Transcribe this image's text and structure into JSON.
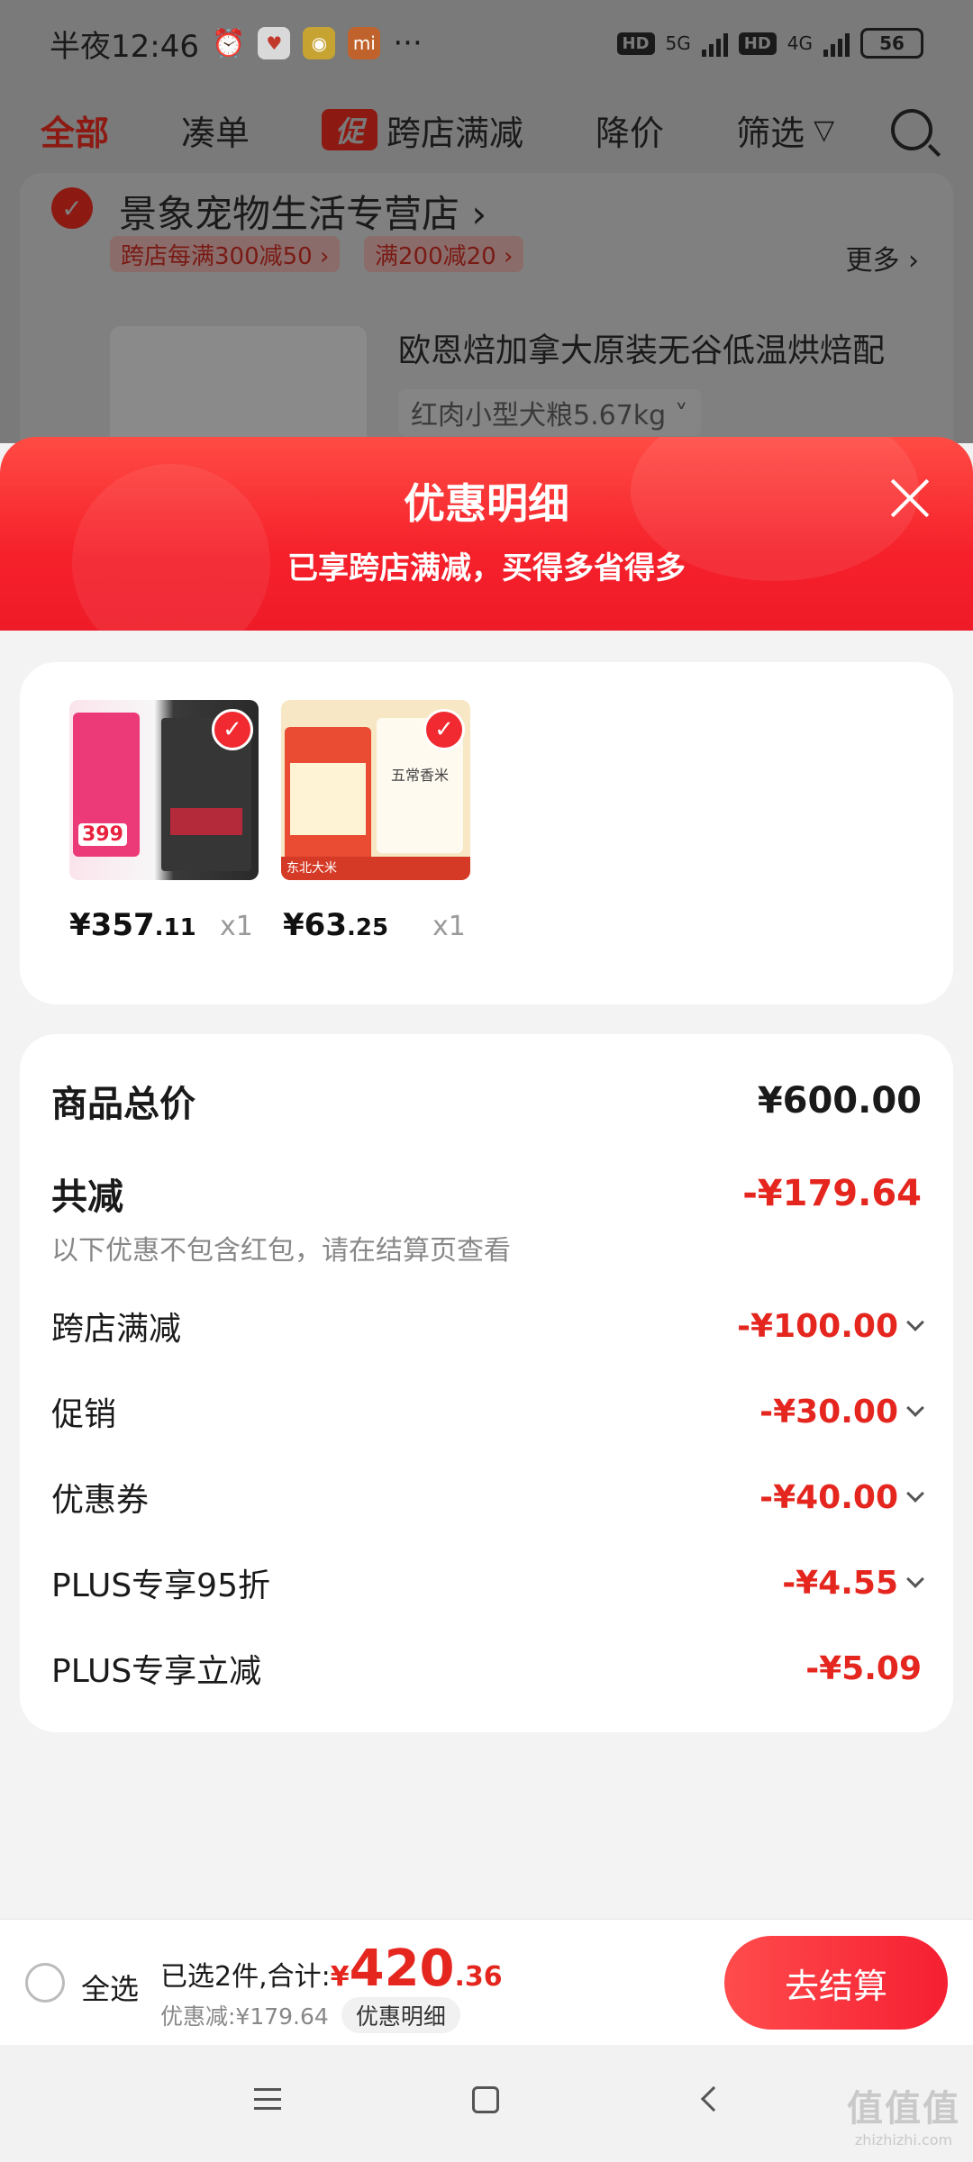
{
  "status_bar": {
    "time": "半夜12:46",
    "net1": "5G",
    "net2": "4G",
    "hd": "HD",
    "battery": "56"
  },
  "top_nav": {
    "tabs": [
      "全部",
      "凑单",
      "跨店满减",
      "降价",
      "筛选"
    ],
    "promo_badge": "促"
  },
  "store": {
    "name": "景象宠物生活专营店",
    "tags": [
      "跨店每满300减50",
      "满200减20"
    ],
    "more": "更多",
    "product_title": "欧恩焙加拿大原装无谷低温烘焙配",
    "product_spec": "红肉小型犬粮5.67kg"
  },
  "sheet": {
    "title": "优惠明细",
    "subtitle": "已享跨店满减，买得多省得多"
  },
  "products": [
    {
      "price_int": "¥357",
      "price_dec": ".11",
      "qty": "x1",
      "badge": "399"
    },
    {
      "price_int": "¥63",
      "price_dec": ".25",
      "qty": "x1",
      "label": "五常香米",
      "bottom_text": "东北大米"
    }
  ],
  "details": {
    "total_label": "商品总价",
    "total_value": "¥600.00",
    "reduce_label": "共减",
    "reduce_value": "-¥179.64",
    "note": "以下优惠不包含红包，请在结算页查看",
    "items": [
      {
        "label": "跨店满减",
        "value": "-¥100.00"
      },
      {
        "label": "促销",
        "value": "-¥30.00"
      },
      {
        "label": "优惠券",
        "value": "-¥40.00"
      },
      {
        "label": "PLUS专享95折",
        "value": "-¥4.55"
      },
      {
        "label": "PLUS专享立减",
        "value": "-¥5.09"
      }
    ]
  },
  "bottom_bar": {
    "select_all": "全选",
    "summary": "已选2件,合计:",
    "currency": "¥",
    "total_int": "420",
    "total_dec": ".36",
    "discount": "优惠减:¥179.64",
    "detail_chip": "优惠明细",
    "checkout": "去结算"
  },
  "watermark": {
    "main": "值值值",
    "sub": "zhizhizhi.com"
  },
  "colors": {
    "accent": "#e4261f",
    "header": "#f5202a"
  }
}
